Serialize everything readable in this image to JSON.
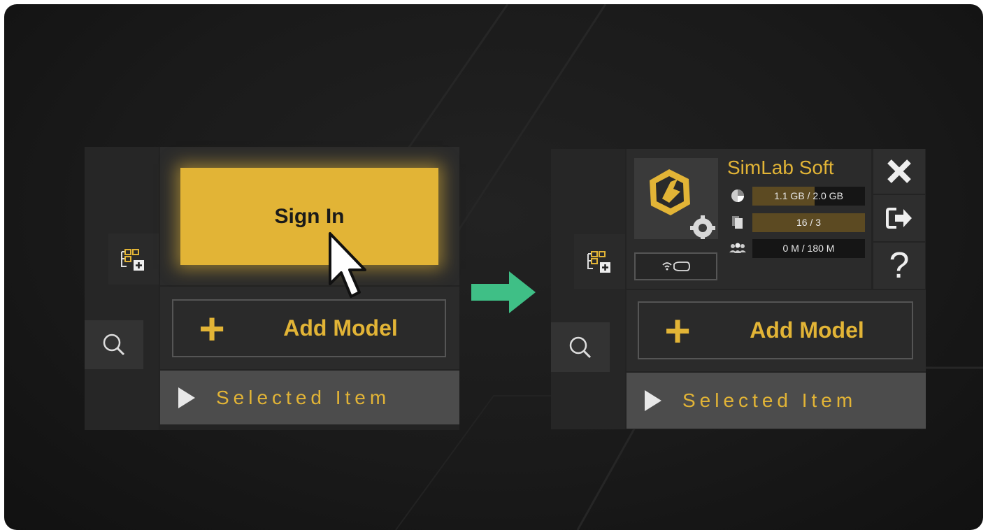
{
  "before": {
    "signin_label": "Sign In",
    "add_model_label": "Add Model",
    "selected_label": "Selected Item"
  },
  "after": {
    "user_name": "SimLab Soft",
    "stats": [
      {
        "icon": "storage-pie-icon",
        "text": "1.1 GB / 2.0 GB",
        "fill": 0.55
      },
      {
        "icon": "pages-icon",
        "text": "16 / 3",
        "fill": 1.0
      },
      {
        "icon": "users-icon",
        "text": "0 M / 180 M",
        "fill": 0.0
      }
    ],
    "add_model_label": "Add Model",
    "selected_label": "Selected Item"
  },
  "colors": {
    "accent": "#e2b436",
    "transition_arrow": "#3fbf86"
  }
}
